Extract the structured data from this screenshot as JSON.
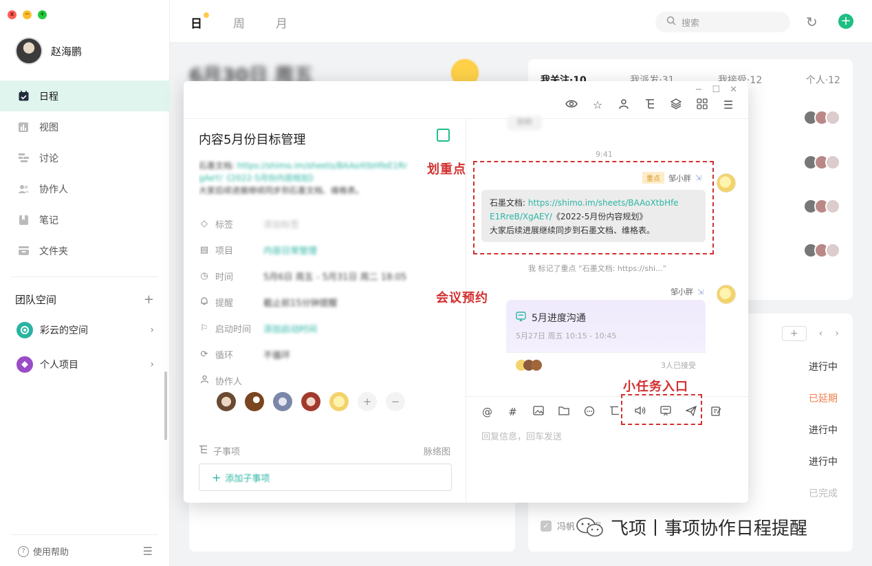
{
  "window": {
    "close": "x",
    "minimize": "−",
    "maximize": "+"
  },
  "user": {
    "name": "赵海鹏"
  },
  "nav": [
    {
      "label": "日程",
      "icon": "calendar-icon",
      "active": true
    },
    {
      "label": "视图",
      "icon": "chart-icon"
    },
    {
      "label": "讨论",
      "icon": "discussion-icon"
    },
    {
      "label": "协作人",
      "icon": "people-icon"
    },
    {
      "label": "笔记",
      "icon": "note-icon"
    },
    {
      "label": "文件夹",
      "icon": "folder-icon"
    }
  ],
  "team": {
    "title": "团队空间",
    "add": "+",
    "spaces": [
      {
        "label": "彩云的空间",
        "icon": "space-icon"
      },
      {
        "label": "个人项目",
        "icon": "project-icon"
      }
    ]
  },
  "help": {
    "label": "使用帮助"
  },
  "topbar": {
    "tabs": [
      "日",
      "周",
      "月"
    ],
    "search_placeholder": "搜索"
  },
  "background": {
    "date_text": "6月30日 周五",
    "filter_tabs": [
      "我关注·10",
      "我派发·31",
      "我接受·12",
      "个人·12"
    ],
    "statuses": [
      {
        "label": "进行中",
        "color": "#333333"
      },
      {
        "label": "已延期",
        "color": "#f07a4a"
      },
      {
        "label": "进行中",
        "color": "#333333"
      },
      {
        "label": "进行中",
        "color": "#333333"
      },
      {
        "label": "已完成",
        "color": "#bbbbbb"
      }
    ],
    "bottom_task": "冯帆 · 场面"
  },
  "modal": {
    "task_title": "内容5月份目标管理",
    "desc_prefix": "石墨文档:",
    "desc_link": "https://shimo.im/sheets/BAAoXtbHfeE1Rr",
    "desc_line2": "gAeY/《2022-5月份内容规划》",
    "desc_line3": "大家后续进展继续同步到石墨文档、维格表。",
    "props": [
      {
        "icon": "tag-icon",
        "label": "标签",
        "value": "添加标签",
        "muted": true
      },
      {
        "icon": "project-icon",
        "label": "项目",
        "value": "内容日常管理",
        "teal": true
      },
      {
        "icon": "clock-icon",
        "label": "时间",
        "value": "5月6日 周五 - 5月31日 周二 18:05"
      },
      {
        "icon": "bell-icon",
        "label": "提醒",
        "value": "截止前15分钟提醒"
      },
      {
        "icon": "flag-icon",
        "label": "启动时间",
        "value": "添加启动时间",
        "teal": true
      },
      {
        "icon": "repeat-icon",
        "label": "循环",
        "value": "不循环"
      },
      {
        "icon": "people-icon",
        "label": "协作人",
        "value": ""
      }
    ],
    "collab_add": "+",
    "collab_remove": "−",
    "subtask_label": "子事项",
    "mindmap_label": "脉络图",
    "add_subtask": "添加子事项"
  },
  "chat": {
    "top_bubble": "好的",
    "time": "9:41",
    "badge": "重点",
    "sender": "邹小胖",
    "doc_prefix": "石墨文档:",
    "doc_link1": "https://shimo.im/sheets/BAAoXtbHfe",
    "doc_link2": "E1RreB/XgAEY/",
    "doc_title": "《2022-5月份内容规划》",
    "doc_line3": "大家后续进展继续同步到石墨文档、维格表。",
    "notice": "我 标记了重点 “石墨文档: https://shi...”",
    "meeting_sender": "邹小胖",
    "meeting_title": "5月进度沟通",
    "meeting_time": "5月27日 周五 10:15 - 10:45",
    "meeting_accepted": "3人已接受",
    "input_placeholder": "回复信息，回车发送"
  },
  "annotations": {
    "highlight": "划重点",
    "meeting": "会议预约",
    "subtask_entry": "小任务入口",
    "color": "#d32f2f"
  },
  "watermark": {
    "text": "飞项丨事项协作日程提醒"
  }
}
